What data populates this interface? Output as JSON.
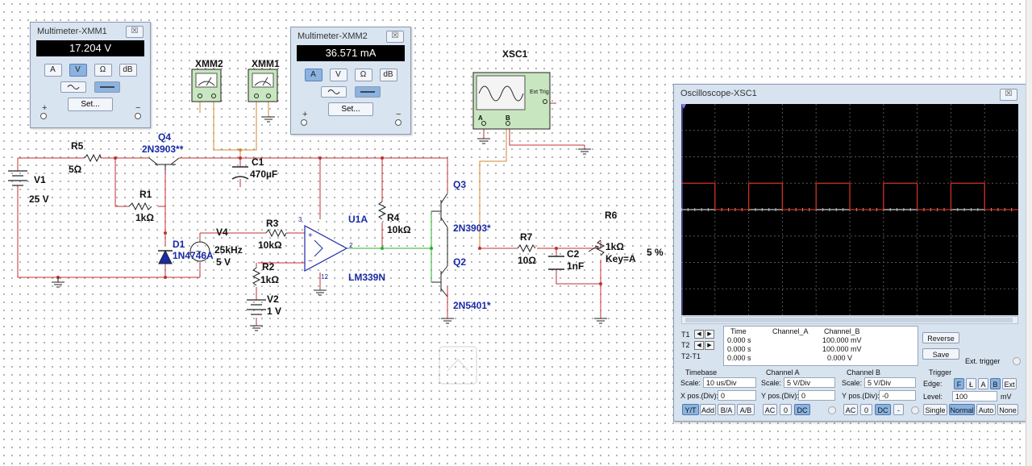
{
  "multimeter1": {
    "title": "Multimeter-XMM1",
    "reading": "17.204 V",
    "modes": [
      "A",
      "V",
      "Ω",
      "dB"
    ],
    "active_mode": "V",
    "set_label": "Set...",
    "plus": "+",
    "minus": "−"
  },
  "multimeter2": {
    "title": "Multimeter-XMM2",
    "reading": "36.571 mA",
    "modes": [
      "A",
      "V",
      "Ω",
      "dB"
    ],
    "active_mode": "A",
    "set_label": "Set...",
    "plus": "+",
    "minus": "−"
  },
  "close_glyph": "☒",
  "schematic": {
    "labels": {
      "xmm2": "XMM2",
      "xmm1": "XMM1",
      "xsc1": "XSC1",
      "r5": "R5",
      "r5_val": "5Ω",
      "v1": "V1",
      "v1_val": "25 V",
      "q4": "Q4",
      "q4_part": "2N3903**",
      "r1": "R1",
      "r1_val": "1kΩ",
      "c1": "C1",
      "c1_val": "470µF",
      "d1": "D1",
      "d1_part": "1N4746A",
      "v4": "V4",
      "v4_freq": "25kHz",
      "v4_amp": "5 V",
      "r3": "R3",
      "r3_val": "10kΩ",
      "r2": "R2",
      "r2_val": "1kΩ",
      "v2": "V2",
      "v2_val": "1 V",
      "u1a": "U1A",
      "u1a_part": "LM339N",
      "r4": "R4",
      "r4_val": "10kΩ",
      "q3": "Q3",
      "q3_part": "2N3903*",
      "q2": "Q2",
      "q2_part": "2N5401*",
      "r7": "R7",
      "r7_val": "10Ω",
      "c2": "C2",
      "c2_val": "1nF",
      "r6": "R6",
      "r6_val": "1kΩ",
      "r6_key": "Key=A",
      "r6_pct": "5 %",
      "ext_trig": "Ext Trig",
      "pin3": "3",
      "pin2": "2",
      "pin12": "12",
      "a": "A",
      "b": "B"
    }
  },
  "oscilloscope": {
    "title": "Oscilloscope-XSC1",
    "channel_a_color": "#ffffff",
    "channel_b_color": "#d03020",
    "channel_b_wave": {
      "high_div": 1,
      "period_div": 2,
      "duty": 0.5,
      "first_rise_div": 0.0
    },
    "readout": {
      "headers": [
        "Time",
        "Channel_A",
        "Channel_B"
      ],
      "rows": [
        {
          "label": "T1",
          "time": "0.000 s",
          "a": "",
          "b": "100.000 mV"
        },
        {
          "label": "T2",
          "time": "0.000 s",
          "a": "",
          "b": "100.000 mV"
        },
        {
          "label": "T2-T1",
          "time": "0.000 s",
          "a": "",
          "b": "0.000 V"
        }
      ]
    },
    "reverse_label": "Reverse",
    "save_label": "Save",
    "ext_trigger_label": "Ext. trigger",
    "timebase": {
      "heading": "Timebase",
      "scale_label": "Scale:",
      "scale": "10 us/Div",
      "xpos_label": "X pos.(Div):",
      "xpos": "0",
      "buttons": [
        "Y/T",
        "Add",
        "B/A",
        "A/B"
      ],
      "active": "Y/T"
    },
    "channel_a": {
      "heading": "Channel A",
      "scale_label": "Scale:",
      "scale": "5 V/Div",
      "ypos_label": "Y pos.(Div):",
      "ypos": "0",
      "buttons": [
        "AC",
        "0",
        "DC"
      ],
      "active": "DC"
    },
    "channel_b": {
      "heading": "Channel B",
      "scale_label": "Scale:",
      "scale": "5 V/Div",
      "ypos_label": "Y pos.(Div):",
      "ypos": "-0",
      "buttons": [
        "AC",
        "0",
        "DC",
        "-"
      ],
      "active": "DC"
    },
    "trigger": {
      "heading": "Trigger",
      "edge_label": "Edge:",
      "edge_buttons": [
        "F",
        "Ł",
        "A",
        "B",
        "Ext"
      ],
      "active_edge": "B",
      "level_label": "Level:",
      "level": "100",
      "level_unit": "mV",
      "mode_buttons": [
        "Single",
        "Normal",
        "Auto",
        "None"
      ],
      "active_mode": "Normal"
    }
  }
}
